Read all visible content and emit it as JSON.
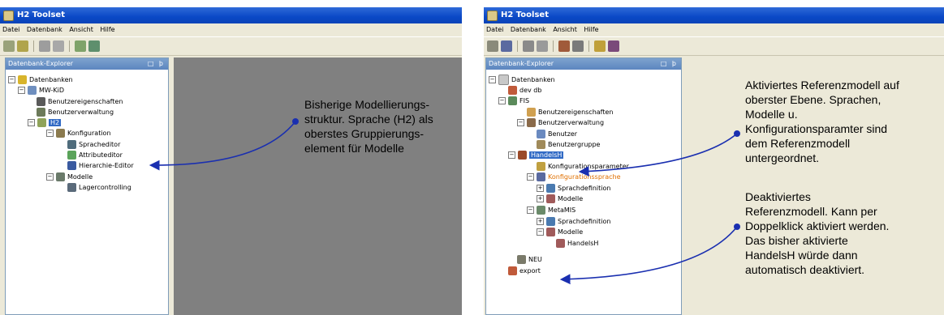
{
  "left": {
    "title": "H2 Toolset",
    "menu": [
      "Datei",
      "Datenbank",
      "Ansicht",
      "Hilfe"
    ],
    "panel_title": "Datenbank-Explorer",
    "panel_buttons": "□ þ",
    "tree": {
      "root": "Datenbanken",
      "db": "MW-KiD",
      "benutzereigenschaften": "Benutzereigenschaften",
      "benutzerverwaltung": "Benutzerverwaltung",
      "h2": "H2",
      "konfiguration": "Konfiguration",
      "spracheditor": "Spracheditor",
      "attributeditor": "Attributeditor",
      "hierarchie": "Hierarchie-Editor",
      "modelle": "Modelle",
      "lagercontrolling": "Lagercontrolling"
    },
    "callout": "Bisherige Modellierungs-\nstruktur. Sprache (H2) als\noberstes Gruppierungs-\nelement für Modelle"
  },
  "right": {
    "title": "H2 Toolset",
    "menu": [
      "Datei",
      "Datenbank",
      "Ansicht",
      "Hilfe"
    ],
    "panel_title": "Datenbank-Explorer",
    "panel_buttons": "□ þ",
    "tree": {
      "root": "Datenbanken",
      "devdb": "dev db",
      "fis": "FIS",
      "benutzereigenschaften": "Benutzereigenschaften",
      "benutzerverwaltung": "Benutzerverwaltung",
      "benutzer": "Benutzer",
      "benutzergruppe": "Benutzergruppe",
      "handelsh": "HandelsH",
      "konfigurationsparameter": "Konfigurationsparameter",
      "konfigurationssprache": "Konfigurationssprache",
      "sprachdefinition1": "Sprachdefinition",
      "modelle1": "Modelle",
      "metamis": "MetaMIS",
      "sprachdefinition2": "Sprachdefinition",
      "modelle2": "Modelle",
      "handelsh2": "HandelsH",
      "neu": "NEU",
      "export": "export"
    },
    "callout1": "Aktiviertes Referenzmodell auf\noberster Ebene. Sprachen,\nModelle u.\nKonfigurationsparamter sind\ndem Referenzmodell\nuntergeordnet.",
    "callout2": "Deaktiviertes\nReferenzmodell. Kann per\nDoppelklick aktiviert werden.\nDas bisher aktivierte\nHandelsH würde dann\nautomatisch deaktiviert."
  },
  "colors": {
    "titlebar": "#0a48c6",
    "workspace": "#808080",
    "selection": "#316ac5",
    "arrow": "#1a2fb0",
    "orange_text": "#e07000"
  }
}
